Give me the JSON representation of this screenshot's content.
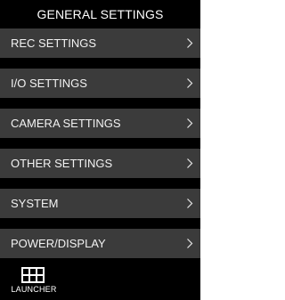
{
  "header": {
    "title": "GENERAL SETTINGS"
  },
  "menu": {
    "items": [
      {
        "label": "REC SETTINGS",
        "icon": "chevron-right-icon"
      },
      {
        "label": "I/O SETTINGS",
        "icon": "chevron-right-icon"
      },
      {
        "label": "CAMERA SETTINGS",
        "icon": "chevron-right-icon"
      },
      {
        "label": "OTHER SETTINGS",
        "icon": "chevron-right-icon"
      },
      {
        "label": "SYSTEM",
        "icon": "chevron-right-icon"
      },
      {
        "label": "POWER/DISPLAY",
        "icon": "chevron-right-icon"
      }
    ]
  },
  "footer": {
    "launcher_label": "LAUNCHER",
    "launcher_icon": "grid-icon"
  },
  "colors": {
    "background": "#000000",
    "menu_item_bg": "#3b3b3b",
    "text": "#ffffff"
  }
}
